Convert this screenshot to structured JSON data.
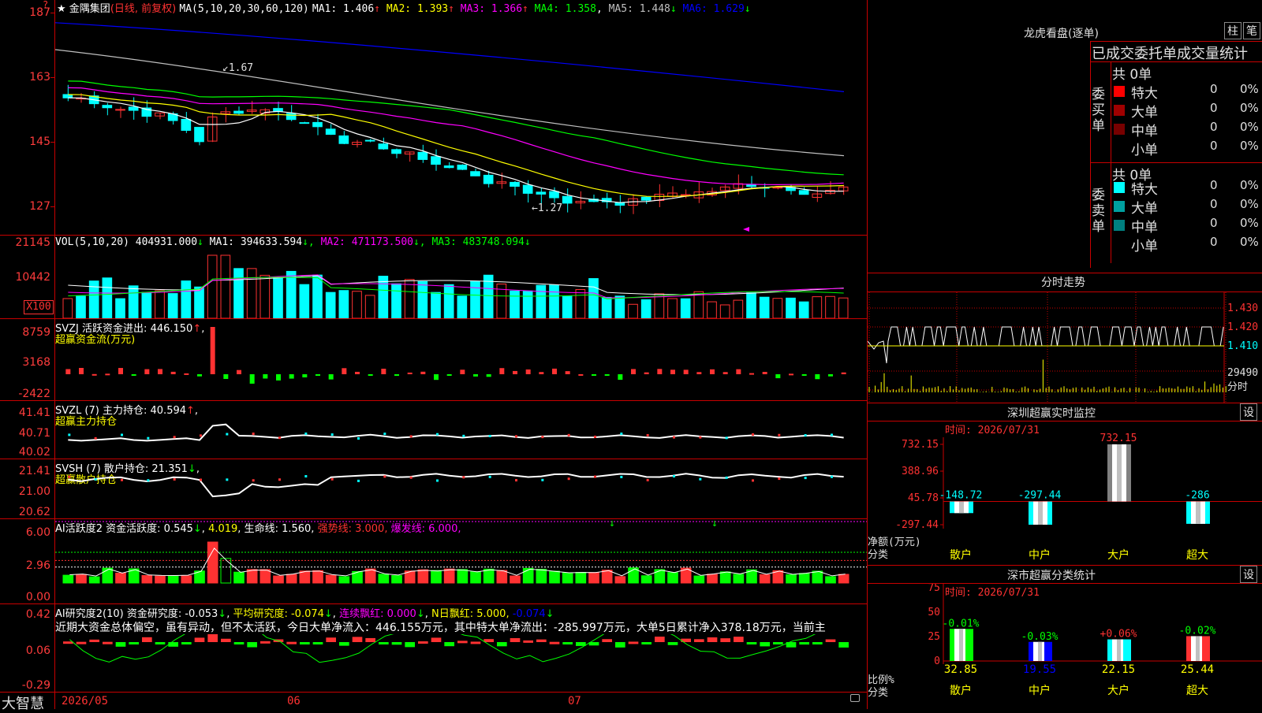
{
  "colors": {
    "up": "#ff3232",
    "down": "#00ffff",
    "grid": "#c80000",
    "ma1": "#ffffff",
    "ma2": "#ffff00",
    "ma3": "#ff00ff",
    "ma4": "#00ff00",
    "ma5": "#c0c0c0",
    "ma6": "#0000ff",
    "green": "#00ff00",
    "yellow": "#ffff00"
  },
  "header": {
    "star": "★",
    "title": "金隅集团",
    "period": "(日线, 前复权)",
    "ma_params": "MA(5,10,20,30,60,120)",
    "ma": [
      {
        "label": "MA1:",
        "value": "1.406",
        "arrow": "↑"
      },
      {
        "label": "MA2:",
        "value": "1.393",
        "arrow": "↑"
      },
      {
        "label": "MA3:",
        "value": "1.366",
        "arrow": "↑"
      },
      {
        "label": "MA4:",
        "value": "1.358",
        "arrow": ","
      },
      {
        "label": "MA5:",
        "value": "1.448",
        "arrow": "↓"
      },
      {
        "label": "MA6:",
        "value": "1.629",
        "arrow": "↓"
      }
    ]
  },
  "price_axis": [
    "187",
    "163",
    "145",
    "127"
  ],
  "price_annotations": {
    "high": "1.67",
    "low": "1.27"
  },
  "volume": {
    "label": "VOL(5,10,20)",
    "value": "404931.000",
    "arrow": "↓",
    "ma": [
      {
        "label": "MA1:",
        "value": "394633.594",
        "arrow": "↓"
      },
      {
        "label": "MA2:",
        "value": "471173.500",
        "arrow": "↓"
      },
      {
        "label": "MA3:",
        "value": "483748.094",
        "arrow": "↓"
      }
    ],
    "axis": [
      "21145",
      "10442"
    ],
    "unit": "X100"
  },
  "svzj": {
    "title": "SVZJ",
    "name": "活跃资金进出:",
    "value": "446.150",
    "arrow": "↑",
    "comma": ",",
    "sub": "超赢资金流(万元)",
    "axis": [
      "8759",
      "3168",
      "-2422"
    ]
  },
  "svzl": {
    "title": "SVZL (7)",
    "name": "主力持仓:",
    "value": "40.594",
    "arrow": "↑",
    "comma": ",",
    "sub": "超赢主力持仓",
    "axis": [
      "41.41",
      "40.71",
      "40.02"
    ]
  },
  "svsh": {
    "title": "SVSH (7)",
    "name": "散户持仓:",
    "value": "21.351",
    "arrow": "↓",
    "comma": ",",
    "sub": "超赢散户持仓",
    "axis": [
      "21.41",
      "21.00",
      "20.62"
    ]
  },
  "ai1": {
    "title": "AI活跃度2",
    "name": "资金活跃度:",
    "value": "0.545",
    "arrow": "↓",
    "v2": "4.019",
    "arrow2": ",",
    "life": "生命线: 1.560,",
    "strong": "强势线: 3.000,",
    "burst": "爆发线: 6.000,",
    "axis": [
      "6.00",
      "2.96",
      "0.00"
    ]
  },
  "ai2": {
    "title": "AI研究度2(10)",
    "name": "资金研究度:",
    "value": "-0.053",
    "arrow": "↓",
    "avg": "平均研究度: -0.074",
    "arrow_avg": "↓",
    "red": "连续飘红: 0.000",
    "arrow_red": "↓",
    "nred": "N日飘红: 5.000,",
    "last": "-0.074",
    "arrow_last": "↓",
    "text": "近期大资金总体偏空，虽有异动，但不太活跃，今日大单净流入：446.155万元，其中特大单净流出：-285.997万元，大单5日累计净入378.18万元，当前主",
    "axis": [
      "0.42",
      "0.06",
      "-0.29"
    ]
  },
  "xaxis": {
    "brand": "大智慧",
    "labels": [
      "2026/05",
      "06",
      "07"
    ]
  },
  "right": {
    "dragon_title": "龙虎看盘(逐单)",
    "btn_zhu": "柱",
    "btn_bi": "笔",
    "tabs": "已成交委托单成交量统计",
    "buy": {
      "label": "委买单",
      "total": "共 0单",
      "rows": [
        {
          "name": "特大",
          "count": "0",
          "pct": "0%",
          "color": "#ff0000"
        },
        {
          "name": "大单",
          "count": "0",
          "pct": "0%",
          "color": "#a00000"
        },
        {
          "name": "中单",
          "count": "0",
          "pct": "0%",
          "color": "#780000"
        },
        {
          "name": "小单",
          "count": "0",
          "pct": "0%",
          "color": "#000000"
        }
      ]
    },
    "sell": {
      "label": "委卖单",
      "total": "共 0单",
      "rows": [
        {
          "name": "特大",
          "count": "0",
          "pct": "0%",
          "color": "#00ffff"
        },
        {
          "name": "大单",
          "count": "0",
          "pct": "0%",
          "color": "#00a0a0"
        },
        {
          "name": "中单",
          "count": "0",
          "pct": "0%",
          "color": "#008080"
        },
        {
          "name": "小单",
          "count": "0",
          "pct": "0%",
          "color": "#000000"
        }
      ]
    },
    "intraday": {
      "title": "分时走势",
      "axis": [
        "1.430",
        "1.420",
        "1.410",
        "29490",
        "分时"
      ]
    },
    "monitor": {
      "title": "深圳超赢实时监控",
      "btn": "设",
      "time": "时间: 2026/07/31",
      "axis": [
        "732.15",
        "388.96",
        "45.78",
        "-297.44"
      ],
      "net_label": "净额(万元)",
      "cat_label": "分类",
      "bars": [
        {
          "cat": "散户",
          "value": -148.72,
          "label": "-148.72"
        },
        {
          "cat": "中户",
          "value": -297.44,
          "label": "-297.44"
        },
        {
          "cat": "大户",
          "value": 732.15,
          "label": "732.15"
        },
        {
          "cat": "超大",
          "value": -286,
          "label": "-286"
        }
      ]
    },
    "stats": {
      "title": "深市超赢分类统计",
      "btn": "设",
      "time": "时间: 2026/07/31",
      "axis": [
        "75",
        "50",
        "25",
        "0"
      ],
      "ratio_label": "比例%",
      "cat_label": "分类",
      "bars": [
        {
          "cat": "散户",
          "value": 32.85,
          "delta": "-0.01%"
        },
        {
          "cat": "中户",
          "value": 19.55,
          "delta": "-0.03%"
        },
        {
          "cat": "大户",
          "value": 22.15,
          "delta": "+0.06%"
        },
        {
          "cat": "超大",
          "value": 25.44,
          "delta": "-0.02%"
        }
      ]
    }
  }
}
